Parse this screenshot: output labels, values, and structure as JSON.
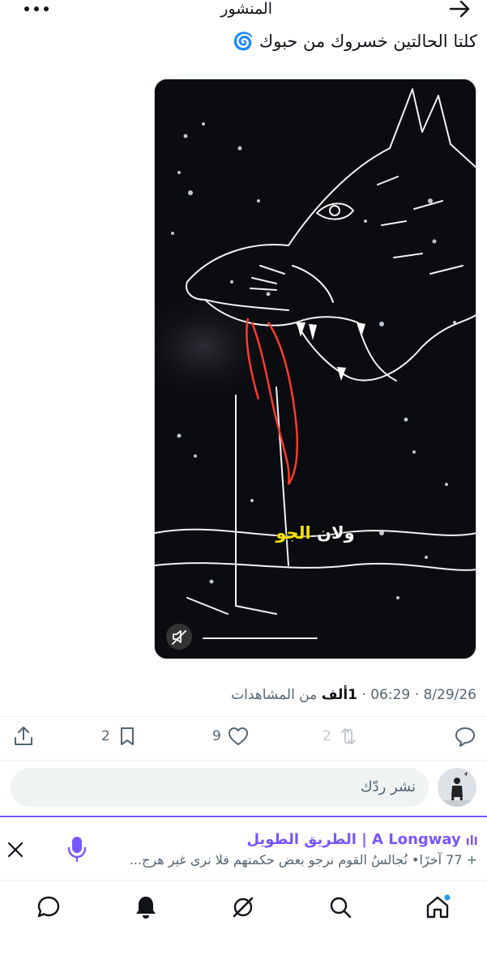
{
  "header": {
    "title": "المنشور",
    "back_icon": "arrow-right-icon",
    "more_icon": "more-dots-icon"
  },
  "post": {
    "text": "كلتا الحالتين خسروك من حبوك",
    "emoji": "🌀",
    "media": {
      "caption_white": "ولان",
      "caption_yellow": "الجو",
      "mute_icon": "muted-speaker-icon"
    },
    "meta": {
      "date": "8/29/26",
      "time": "06:29",
      "views_number": "1ألف",
      "views_label": "من المشاهدات"
    },
    "actions": {
      "reply_count": "",
      "repost_count": "2",
      "like_count": "9",
      "bookmark_count": "2"
    }
  },
  "reply": {
    "placeholder": "نشر ردّك"
  },
  "space": {
    "title": "A Longway | الطريق الطويل",
    "subtitle": "+ 77 آخرًا•  نُجالسُ القوم نرجو بعض حكمتهم فلا نرى غير هرجٍ..."
  },
  "colors": {
    "accent": "#7856ff",
    "secondary_text": "#536471",
    "primary_text": "#0f1419",
    "badge": "#1d9bf0"
  },
  "nav": [
    "home-icon",
    "search-icon",
    "grok-icon",
    "notifications-icon",
    "messages-icon"
  ]
}
